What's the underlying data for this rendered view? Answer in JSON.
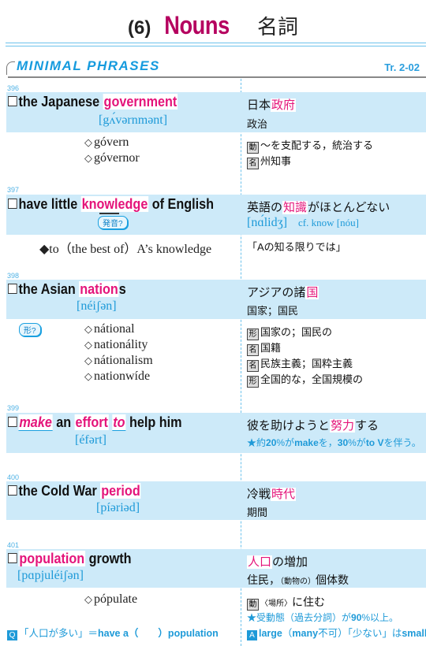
{
  "header": {
    "chapter_number": "(6)",
    "title_en": "Nouns",
    "title_jp": "名詞",
    "section_title": "MINIMAL PHRASES",
    "track": "Tr. 2-02"
  },
  "colors": {
    "accent_blue": "#1e9ad8",
    "highlight_pink": "#e4147a",
    "title_magenta": "#b5005f",
    "band_blue": "#cdeaf9"
  },
  "entries": [
    {
      "number": "396",
      "phrase": {
        "before": "the Japanese ",
        "keyword": "government",
        "after": ""
      },
      "pronunciation": "[gʌ́vərnmənt]",
      "jp_main": {
        "before": "日本",
        "keyword": "政府",
        "after": ""
      },
      "jp_sub": "政治",
      "derivatives": [
        {
          "word": "góvern",
          "pos": "動",
          "meaning": "～を支配する，統治する"
        },
        {
          "word": "góvernor",
          "pos": "名",
          "meaning": "州知事"
        }
      ]
    },
    {
      "number": "397",
      "phrase": {
        "before": "have little ",
        "keyword": "knowledge",
        "after": " of English"
      },
      "badge": "発音?",
      "jp_main": {
        "before": "英語の",
        "keyword": "知識",
        "after": "がほとんどない"
      },
      "pronunciation": "[nɑ́lidʒ]",
      "cf": "cf. know [nóu]",
      "idiom": {
        "text": "◆to（the best of）A’s knowledge",
        "meaning": "「Aの知る限りでは」"
      }
    },
    {
      "number": "398",
      "phrase": {
        "before": "the Asian ",
        "keyword": "nation",
        "after": "s"
      },
      "pronunciation": "[néiʃən]",
      "badge": "形?",
      "jp_main": {
        "before": "アジアの諸",
        "keyword": "国",
        "after": ""
      },
      "jp_sub": "国家；国民",
      "derivatives": [
        {
          "word": "nátional",
          "pos": "形",
          "meaning": "国家の；国民の"
        },
        {
          "word": "nationálity",
          "pos": "名",
          "meaning": "国籍"
        },
        {
          "word": "nátionalism",
          "pos": "名",
          "meaning": "民族主義；国粋主義"
        },
        {
          "word": "nationwíde",
          "pos": "形",
          "meaning": "全国的な，全国規模の"
        }
      ]
    },
    {
      "number": "399",
      "phrase": {
        "w1": "make",
        "w2": " an ",
        "keyword": "effort",
        "w3": " ",
        "w4": "to",
        "after": " help him"
      },
      "pronunciation": "[éfərt]",
      "jp_main": {
        "before": "彼を助けようと",
        "keyword": "努力",
        "after": "する"
      },
      "note": {
        "star": "★",
        "t1": "約",
        "n1": "20",
        "t2": "%が",
        "k1": "make",
        "t3": "を，",
        "n2": "30",
        "t4": "%が",
        "k2": "to V",
        "t5": "を伴う。"
      }
    },
    {
      "number": "400",
      "phrase": {
        "before": "the Cold War ",
        "keyword": "period",
        "after": ""
      },
      "pronunciation": "[píəriəd]",
      "jp_main": {
        "before": "冷戦",
        "keyword": "時代",
        "after": ""
      },
      "jp_sub": "期間"
    },
    {
      "number": "401",
      "phrase": {
        "before": "",
        "keyword": "population",
        "after": " growth"
      },
      "pronunciation": "[pɑpjuléiʃən]",
      "jp_main": {
        "before": "",
        "keyword": "人口",
        "after": "の増加"
      },
      "jp_sub": {
        "a": "住民，",
        "b": "（動物の）",
        "c": "個体数"
      },
      "derivatives": [
        {
          "word": "pópulate",
          "pos": "動",
          "meaning_small": "〈場所〉",
          "meaning": "に住む"
        }
      ],
      "note": {
        "star": "★",
        "t1": "受動態（過去分詞）が",
        "n1": "90",
        "t2": "%以上。"
      },
      "question": {
        "icon": "Q",
        "t1": "「人口が多い」＝",
        "t2": "have a（　　）population"
      },
      "answer": {
        "icon": "A",
        "t1": "large",
        "t2": "（",
        "t3": "many",
        "t4": "不可）「少ない」は",
        "t5": "small",
        "t6": "。"
      }
    }
  ]
}
